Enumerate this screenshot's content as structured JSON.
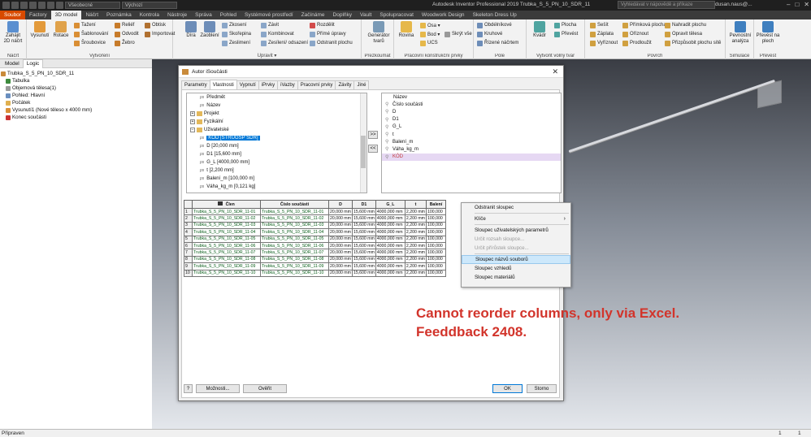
{
  "titlebar": {
    "material_select": "Všeobecné",
    "appearance_select": "Výchozí",
    "app_title": "Autodesk Inventor Professional 2019    Trubka_S_5_PN_10_SDR_11",
    "help_search_placeholder": "Vyhledávat v nápovědě a příkaze",
    "user": "dusan.naus@...",
    "window_controls": [
      "–",
      "□",
      "✕"
    ]
  },
  "ribbon_tabs": [
    "Soubor",
    "Factory",
    "3D model",
    "Náčrt",
    "Poznámka",
    "Kontrola",
    "Nástroje",
    "Správa",
    "Pohled",
    "Systémové prostředí",
    "Začínáme",
    "Doplňky",
    "Vault",
    "Spolupracovat",
    "Woodwork Design",
    "Skeleton Dress Up"
  ],
  "ribbon": {
    "groups": {
      "nacrt": {
        "label": "Náčrt",
        "btn": "Zahájit 2D náčrt"
      },
      "vytvoreni": {
        "label": "Vytvoření",
        "big": [
          "Vysunutí",
          "Rotace"
        ],
        "small": [
          "Tažení",
          "Šablonování",
          "Šroubovice",
          "Reliéf",
          "Odvodit",
          "Žebro",
          "Obtisk",
          "Importovat"
        ]
      },
      "upravit": {
        "label": "Upravit ▾",
        "big": [
          "Díra",
          "Zaoblení"
        ],
        "small": [
          "Zkosení",
          "Skořepina",
          "Zeslimení",
          "Závit",
          "Kombinovat",
          "Zesílení/ odsazení",
          "Rozdělit",
          "Přímé úpravy",
          "Odstranit plochu"
        ]
      },
      "prezkoumat": {
        "label": "Prezkoumat",
        "btn": "Generátor tvarů"
      },
      "pracovni": {
        "label": "Pracovní konstrukční prvky",
        "big": [
          "Rovina"
        ],
        "small": [
          "Osa ▾",
          "Bod ▾",
          "UCS"
        ],
        "btn2": "Skrýt vše"
      },
      "pole": {
        "label": "Pole",
        "small": [
          "Obdélníkové",
          "Kruhové",
          "Řízené náčrtem"
        ]
      },
      "volny": {
        "label": "Vytvořit volný tvar",
        "btn": "Kvádr",
        "small": [
          "Plocha",
          "Převést"
        ]
      },
      "povrch": {
        "label": "Povrch",
        "small": [
          "Sešít",
          "Záplata",
          "Vyříznout",
          "Přímková plocha",
          "Oříznout",
          "Prodloužit",
          "Nahradit plochu",
          "Opravit tělesa",
          "Přizpůsobit plochu sítě"
        ]
      },
      "simulace": {
        "label": "Simulace",
        "btn": "Pevnostní analýza"
      },
      "prevest": {
        "label": "Převést",
        "btn": "Převést na plech"
      }
    }
  },
  "leftpanel": {
    "tabs": [
      "Model",
      "Logic"
    ],
    "tree": [
      "Trubka_S_5_PN_10_SDR_11",
      "Tabulka",
      "Objemová tělesa(1)",
      "Pohled: Hlavní",
      "Počátek",
      "Vysunutí1 (Nové těleso x 4000 mm)",
      "Konec součásti"
    ]
  },
  "dialog": {
    "title": "Autor iSoučásti",
    "tabs": [
      "Parametry",
      "Vlastnosti",
      "Vypnutí",
      "iPrvky",
      "iVazby",
      "Pracovní prvky",
      "Závity",
      "Jiné"
    ],
    "property_tree": [
      {
        "ps": "ps",
        "label": "Předmět"
      },
      {
        "ps": "ps",
        "label": "Název"
      },
      {
        "label": "Projekt",
        "group": true
      },
      {
        "label": "Fyzikální",
        "group": true
      },
      {
        "label": "Uživatelské",
        "group": true
      },
      {
        "ps": "ps",
        "label": "KÓD [STRUGSP SDR]",
        "sel": true
      },
      {
        "ps": "ps",
        "label": "D [20,000 mm]"
      },
      {
        "ps": "ps",
        "label": "D1 [15,600 mm]"
      },
      {
        "ps": "ps",
        "label": "G_L [4000,000 mm]"
      },
      {
        "ps": "ps",
        "label": "t [2,200 mm]"
      },
      {
        "ps": "ps",
        "label": "Balení_m [100,000 m]"
      },
      {
        "ps": "ps",
        "label": "Váha_kg_m [0,121 kg]"
      }
    ],
    "move_right": ">>",
    "move_left": "<<",
    "column_list": [
      "Název",
      "Číslo součásti",
      "D",
      "D1",
      "G_L",
      "t",
      "Balení_m",
      "Váha_kg_m",
      "KÓD"
    ],
    "table": {
      "headers": [
        "",
        "Člen",
        "Číslo součásti",
        "D",
        "D1",
        "G_L",
        "t",
        "Balení"
      ],
      "rows": [
        [
          "1",
          "Trubka_S_5_PN_10_SDR_11-01",
          "Trubka_S_5_PN_10_SDR_11-01",
          "20,000 mm",
          "15,600 mm",
          "4000,000 mm",
          "2,200 mm",
          "100,000"
        ],
        [
          "2",
          "Trubka_S_5_PN_10_SDR_11-02",
          "Trubka_S_5_PN_10_SDR_11-02",
          "20,000 mm",
          "15,600 mm",
          "4000,000 mm",
          "2,200 mm",
          "100,000"
        ],
        [
          "3",
          "Trubka_S_5_PN_10_SDR_11-03",
          "Trubka_S_5_PN_10_SDR_11-03",
          "20,000 mm",
          "15,600 mm",
          "4000,000 mm",
          "2,200 mm",
          "100,000"
        ],
        [
          "4",
          "Trubka_S_5_PN_10_SDR_11-04",
          "Trubka_S_5_PN_10_SDR_11-04",
          "20,000 mm",
          "15,600 mm",
          "4000,000 mm",
          "2,200 mm",
          "100,000"
        ],
        [
          "5",
          "Trubka_S_5_PN_10_SDR_11-05",
          "Trubka_S_5_PN_10_SDR_11-05",
          "20,000 mm",
          "15,600 mm",
          "4000,000 mm",
          "2,200 mm",
          "100,000"
        ],
        [
          "6",
          "Trubka_S_5_PN_10_SDR_11-06",
          "Trubka_S_5_PN_10_SDR_11-06",
          "20,000 mm",
          "15,600 mm",
          "4000,000 mm",
          "2,200 mm",
          "100,000"
        ],
        [
          "7",
          "Trubka_S_5_PN_10_SDR_11-07",
          "Trubka_S_5_PN_10_SDR_11-07",
          "20,000 mm",
          "15,600 mm",
          "4000,000 mm",
          "2,200 mm",
          "100,000"
        ],
        [
          "8",
          "Trubka_S_5_PN_10_SDR_11-08",
          "Trubka_S_5_PN_10_SDR_11-08",
          "20,000 mm",
          "15,600 mm",
          "4000,000 mm",
          "2,200 mm",
          "100,000"
        ],
        [
          "9",
          "Trubka_S_5_PN_10_SDR_11-09",
          "Trubka_S_5_PN_10_SDR_11-09",
          "20,000 mm",
          "15,600 mm",
          "4000,000 mm",
          "2,200 mm",
          "100,000"
        ],
        [
          "10",
          "Trubka_S_5_PN_10_SDR_11-10",
          "Trubka_S_5_PN_10_SDR_11-10",
          "20,000 mm",
          "15,600 mm",
          "4000,000 mm",
          "2,200 mm",
          "100,000"
        ]
      ]
    },
    "buttons": {
      "help": "?",
      "options": "Možnosti...",
      "verify": "Ověřit",
      "ok": "OK",
      "cancel": "Storno"
    }
  },
  "context_menu": [
    {
      "label": "Odstranit sloupec",
      "state": "normal"
    },
    {
      "sep": true
    },
    {
      "label": "Klíče",
      "state": "normal",
      "sub": true
    },
    {
      "sep": true
    },
    {
      "label": "Sloupec uživatelských parametrů",
      "state": "normal"
    },
    {
      "label": "Určit rozsah sloupce...",
      "state": "disabled"
    },
    {
      "label": "Určit přírůstek sloupce...",
      "state": "disabled"
    },
    {
      "sep": true
    },
    {
      "label": "Sloupec názvů souborů",
      "state": "hover"
    },
    {
      "label": "Sloupec vzhledů",
      "state": "normal"
    },
    {
      "label": "Sloupec materiálů",
      "state": "normal"
    }
  ],
  "annotation": {
    "line1": "Cannot reorder columns, only via Excel.",
    "line2": "Feeddback 2408."
  },
  "statusbar": {
    "text": "Připraven",
    "num1": "1",
    "num2": "1"
  },
  "colors": {
    "file_tab": "#d84a00",
    "selection": "#0078d7",
    "annotation": "#d2342b",
    "menu_hover": "#cde8fb"
  }
}
